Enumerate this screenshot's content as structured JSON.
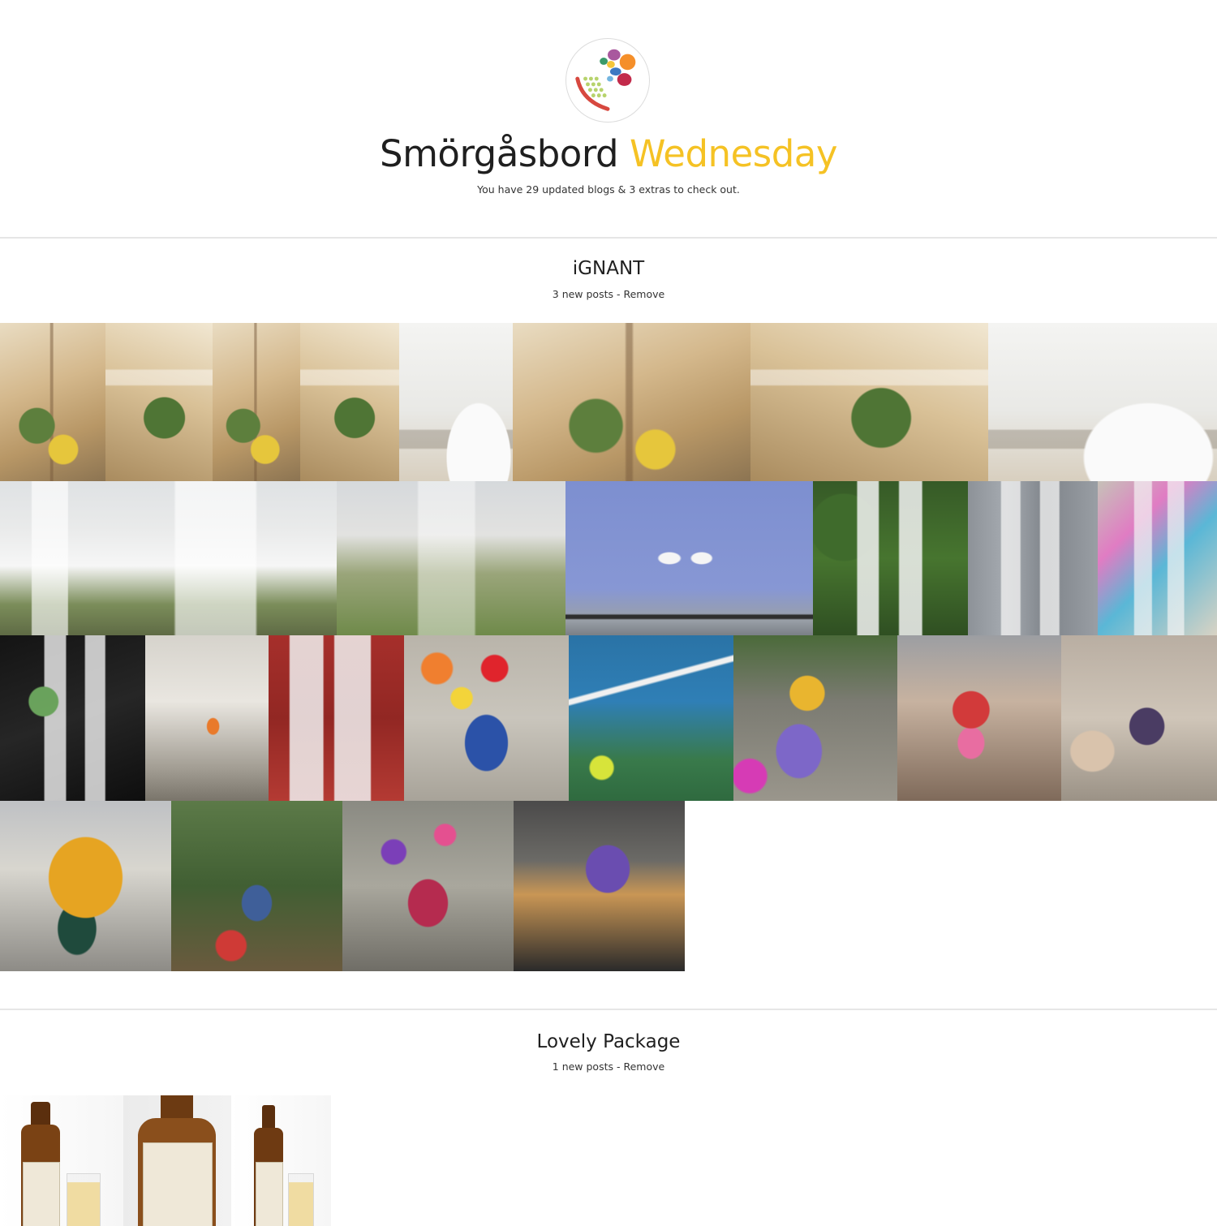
{
  "app": {
    "title_main": "Smörgåsbord",
    "title_accent": "Wednesday",
    "summary": "You have 29 updated blogs & 3 extras to check out.",
    "accent_color": "#f5c224"
  },
  "logo": {
    "icon": "smorgasbord-plate-icon"
  },
  "sections": [
    {
      "blog_name": "iGNANT",
      "post_count_text": "3 new posts",
      "separator": " - ",
      "remove_label": "Remove",
      "thumbnail_count": 27
    },
    {
      "blog_name": "Lovely Package",
      "post_count_text": "1 new posts",
      "separator": " - ",
      "remove_label": "Remove",
      "thumbnail_count": 3
    }
  ]
}
